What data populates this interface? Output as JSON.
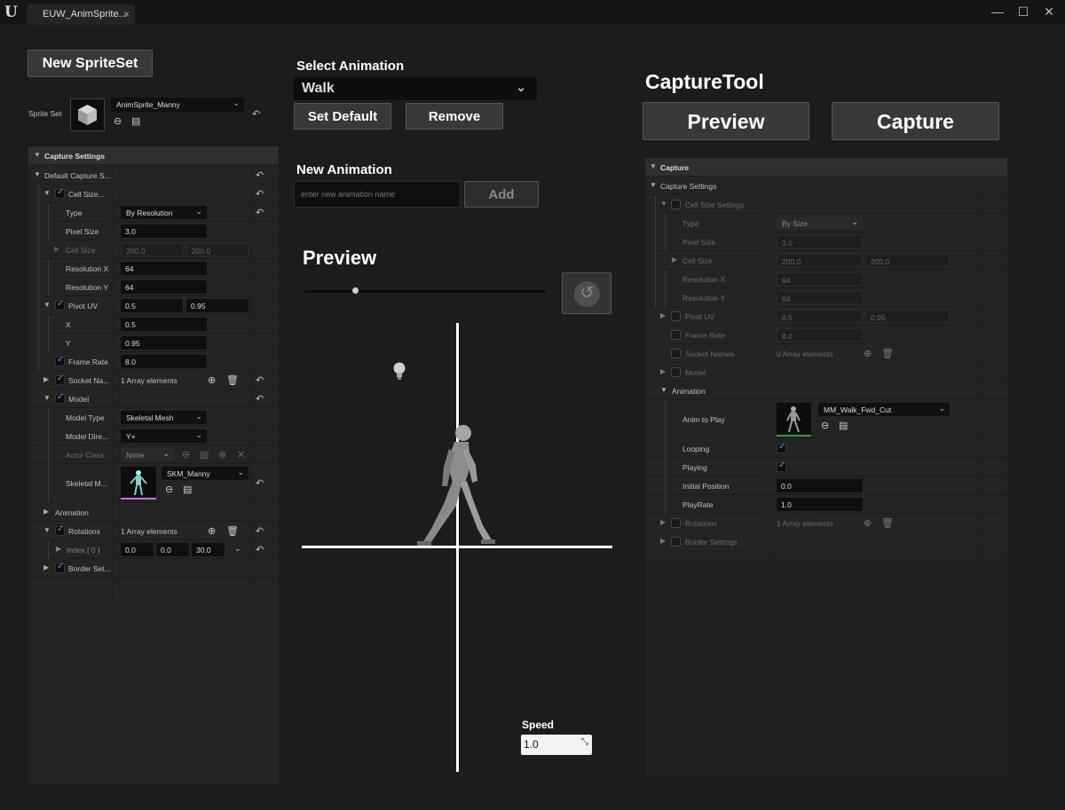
{
  "window": {
    "tab_title": "EUW_AnimSprite...",
    "tab_close": "×",
    "minimize": "—",
    "maximize": "☐",
    "close": "✕"
  },
  "left": {
    "new_spriteset_label": "New SpriteSet",
    "sprite_set_label": "Sprite Set",
    "sprite_set_value": "AnimSprite_Manny",
    "capture_settings_header": "Capture Settings",
    "rows": {
      "default_capture": "Default Capture S...",
      "cell_size": "Cell Size...",
      "type_label": "Type",
      "type_value": "By Resolution",
      "pixel_size_label": "Pixel Size",
      "pixel_size_value": "3.0",
      "cell_size_label": "Cell Size",
      "cell_size_x": "200.0",
      "cell_size_y": "200.0",
      "res_x_label": "Resolution X",
      "res_x_value": "64",
      "res_y_label": "Resolution Y",
      "res_y_value": "64",
      "pivot_label": "Pivot UV",
      "pivot_x": "0.5",
      "pivot_y": "0.95",
      "x_label": "X",
      "x_value": "0.5",
      "y_label": "Y",
      "y_value": "0.95",
      "frame_rate_label": "Frame Rate",
      "frame_rate_value": "8.0",
      "socket_label": "Socket Na...",
      "socket_value": "1 Array elements",
      "model_label": "Model",
      "model_type_label": "Model Type",
      "model_type_value": "Skeletal Mesh",
      "model_dir_label": "Model Dire...",
      "model_dir_value": "Y+",
      "actor_class_label": "Actor Class",
      "actor_class_value": "None",
      "skeletal_label": "Skeletal M...",
      "skeletal_value": "SKM_Manny",
      "animation_label": "Animation",
      "rotations_label": "Rotations",
      "rotations_value": "1 Array elements",
      "index_label": "Index [ 0 ]",
      "index_x": "0.0",
      "index_y": "0.0",
      "index_z": "30.0",
      "border_label": "Border Set..."
    }
  },
  "center": {
    "select_animation_label": "Select Animation",
    "selected_animation": "Walk",
    "set_default_label": "Set Default",
    "remove_label": "Remove",
    "new_animation_label": "New Animation",
    "new_animation_placeholder": "enter new animation name",
    "add_label": "Add",
    "preview_label": "Preview",
    "speed_label": "Speed",
    "speed_value": "1.0",
    "slider_value": 0.21
  },
  "right": {
    "title": "CaptureTool",
    "preview_label": "Preview",
    "capture_label": "Capture",
    "capture_header": "Capture",
    "capture_settings_label": "Capture Settings",
    "cell_size_settings": "Cell Size Settings",
    "type_label": "Type",
    "type_value": "By Size",
    "pixel_size_label": "Pixel Size",
    "pixel_size_value": "3.0",
    "cell_size_label": "Cell Size",
    "cell_size_x": "200.0",
    "cell_size_y": "200.0",
    "res_x_label": "Resolution X",
    "res_x_value": "64",
    "res_y_label": "Resolution Y",
    "res_y_value": "64",
    "pivot_label": "Pivot UV",
    "pivot_x": "0.5",
    "pivot_y": "0.95",
    "frame_rate_label": "Frame Rate",
    "frame_rate_value": "8.0",
    "socket_label": "Socket Names",
    "socket_value": "0 Array elements",
    "model_label": "Model",
    "animation_label": "Animation",
    "anim_to_play_label": "Anim to Play",
    "anim_to_play_value": "MM_Walk_Fwd_Cut",
    "looping_label": "Looping",
    "playing_label": "Playing",
    "initial_pos_label": "Initial Position",
    "initial_pos_value": "0.0",
    "playrate_label": "PlayRate",
    "playrate_value": "1.0",
    "rotations_label": "Rotations",
    "rotations_value": "1 Array elements",
    "border_label": "Border Settings"
  },
  "colors": {
    "checkbox_accent": "#4aa0ff",
    "background": "#1c1c1c",
    "panel": "#242424"
  }
}
